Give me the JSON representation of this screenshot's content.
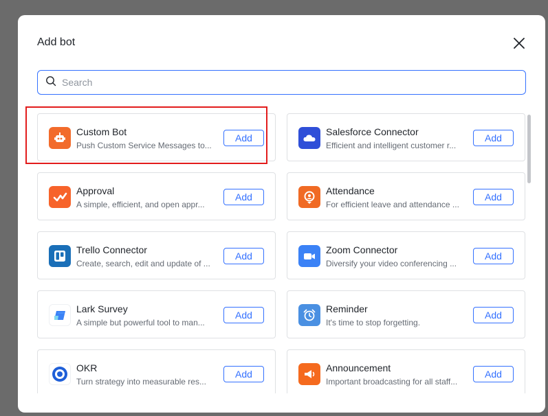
{
  "dialog": {
    "title": "Add bot",
    "close_icon": "close-icon",
    "search": {
      "placeholder": "Search",
      "value": "",
      "icon": "search-icon"
    }
  },
  "bots": [
    {
      "name": "Custom Bot",
      "desc": "Push Custom Service Messages to...",
      "add": "Add",
      "icon": "robot-icon",
      "color": "#f26b2b"
    },
    {
      "name": "Salesforce Connector",
      "desc": "Efficient and intelligent customer r...",
      "add": "Add",
      "icon": "cloud-icon",
      "color": "#2f4fd8"
    },
    {
      "name": "Approval",
      "desc": "A simple, efficient, and open appr...",
      "add": "Add",
      "icon": "approval-check-icon",
      "color": "#f7632a"
    },
    {
      "name": "Attendance",
      "desc": "For efficient leave and attendance ...",
      "add": "Add",
      "icon": "location-pin-icon",
      "color": "#f06a24"
    },
    {
      "name": "Trello Connector",
      "desc": "Create, search, edit and update of ...",
      "add": "Add",
      "icon": "trello-icon",
      "color": "#1a6fb8"
    },
    {
      "name": "Zoom Connector",
      "desc": "Diversify your video conferencing ...",
      "add": "Add",
      "icon": "video-camera-icon",
      "color": "#3b82f6"
    },
    {
      "name": "Lark Survey",
      "desc": "A simple but powerful tool to man...",
      "add": "Add",
      "icon": "survey-icon",
      "color": "#ffffff"
    },
    {
      "name": "Reminder",
      "desc": "It's time to stop forgetting.",
      "add": "Add",
      "icon": "alarm-clock-icon",
      "color": "#4a90e2"
    },
    {
      "name": "OKR",
      "desc": "Turn strategy into measurable res...",
      "add": "Add",
      "icon": "okr-target-icon",
      "color": "#ffffff"
    },
    {
      "name": "Announcement",
      "desc": "Important broadcasting for all staff...",
      "add": "Add",
      "icon": "megaphone-icon",
      "color": "#f56a1e"
    }
  ],
  "colors": {
    "accent": "#3370ff",
    "highlight": "#e21b1b"
  }
}
